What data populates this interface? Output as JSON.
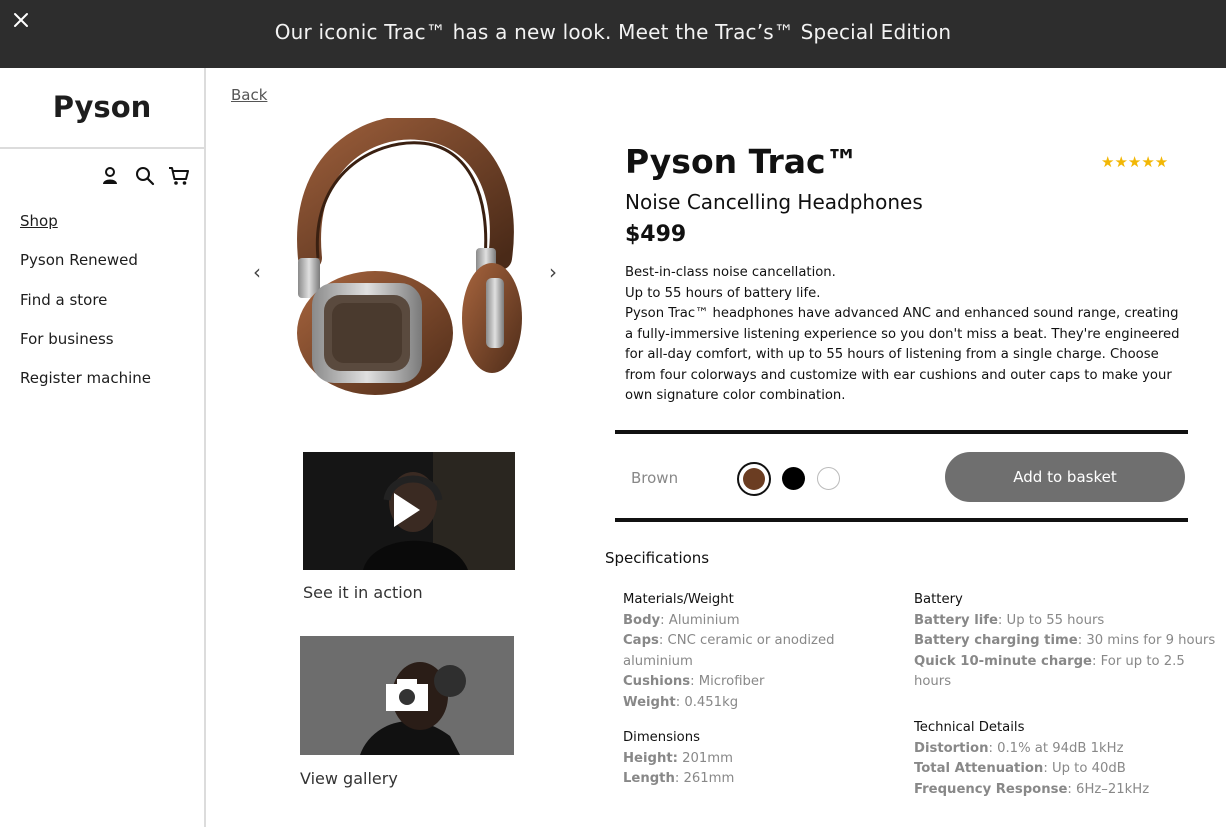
{
  "banner": {
    "text": "Our iconic Trac™ has a new look. Meet the Trac’s™ Special Edition"
  },
  "sidebar": {
    "brand": "Pyson",
    "icons": [
      "user-icon",
      "search-icon",
      "cart-icon"
    ],
    "items": [
      {
        "label": "Shop",
        "active": true
      },
      {
        "label": "Pyson Renewed",
        "active": false
      },
      {
        "label": "Find a store",
        "active": false
      },
      {
        "label": "For business",
        "active": false
      },
      {
        "label": "Register machine",
        "active": false
      }
    ]
  },
  "nav": {
    "back_label": "Back"
  },
  "media": {
    "video_label": "See it in action",
    "gallery_label": "View gallery"
  },
  "product": {
    "name": "Pyson Trac™",
    "subtitle": "Noise Cancelling Headphones",
    "price": "$499",
    "rating": "★★★★★",
    "rating_value": 5,
    "rating_max": 5,
    "description": [
      "Best-in-class noise cancellation.",
      "Up to 55 hours of battery life.",
      "Pyson Trac™ headphones have advanced ANC and enhanced sound range, creating a fully-immersive listening experience so you don't miss a beat. They're engineered for all-day comfort, with up to 55 hours of listening from a single charge. Choose from four colorways and customize with ear cushions and outer caps to make your own signature color combination."
    ],
    "selected_color": "Brown",
    "swatch_colors": [
      "#6b3d22",
      "#000000",
      "#ffffff"
    ],
    "add_to_basket_label": "Add to basket"
  },
  "specs": {
    "title": "Specifications",
    "materials": {
      "heading": "Materials/Weight",
      "rows": [
        {
          "key": "Body",
          "value": ": Aluminium"
        },
        {
          "key": "Caps",
          "value": ": CNC ceramic or anodized aluminium"
        },
        {
          "key": "Cushions",
          "value": ": Microfiber"
        },
        {
          "key": "Weight",
          "value": ": 0.451kg"
        }
      ]
    },
    "dimensions": {
      "heading": "Dimensions",
      "rows": [
        {
          "key": "Height:",
          "value": " 201mm"
        },
        {
          "key": "Length",
          "value": ": 261mm"
        }
      ]
    },
    "battery": {
      "heading": "Battery",
      "rows": [
        {
          "key": "Battery life",
          "value": ": Up to 55 hours"
        },
        {
          "key": "Battery charging time",
          "value": ": 30 mins for 9 hours"
        },
        {
          "key": "Quick 10-minute charge",
          "value": ": For up to 2.5 hours"
        }
      ]
    },
    "technical": {
      "heading": "Technical Details",
      "rows": [
        {
          "key": "Distortion",
          "value": ": 0.1% at 94dB 1kHz"
        },
        {
          "key": "Total Attenuation",
          "value": ": Up to 40dB"
        },
        {
          "key": "Frequency Response",
          "value": ": 6Hz–21kHz"
        }
      ]
    }
  }
}
